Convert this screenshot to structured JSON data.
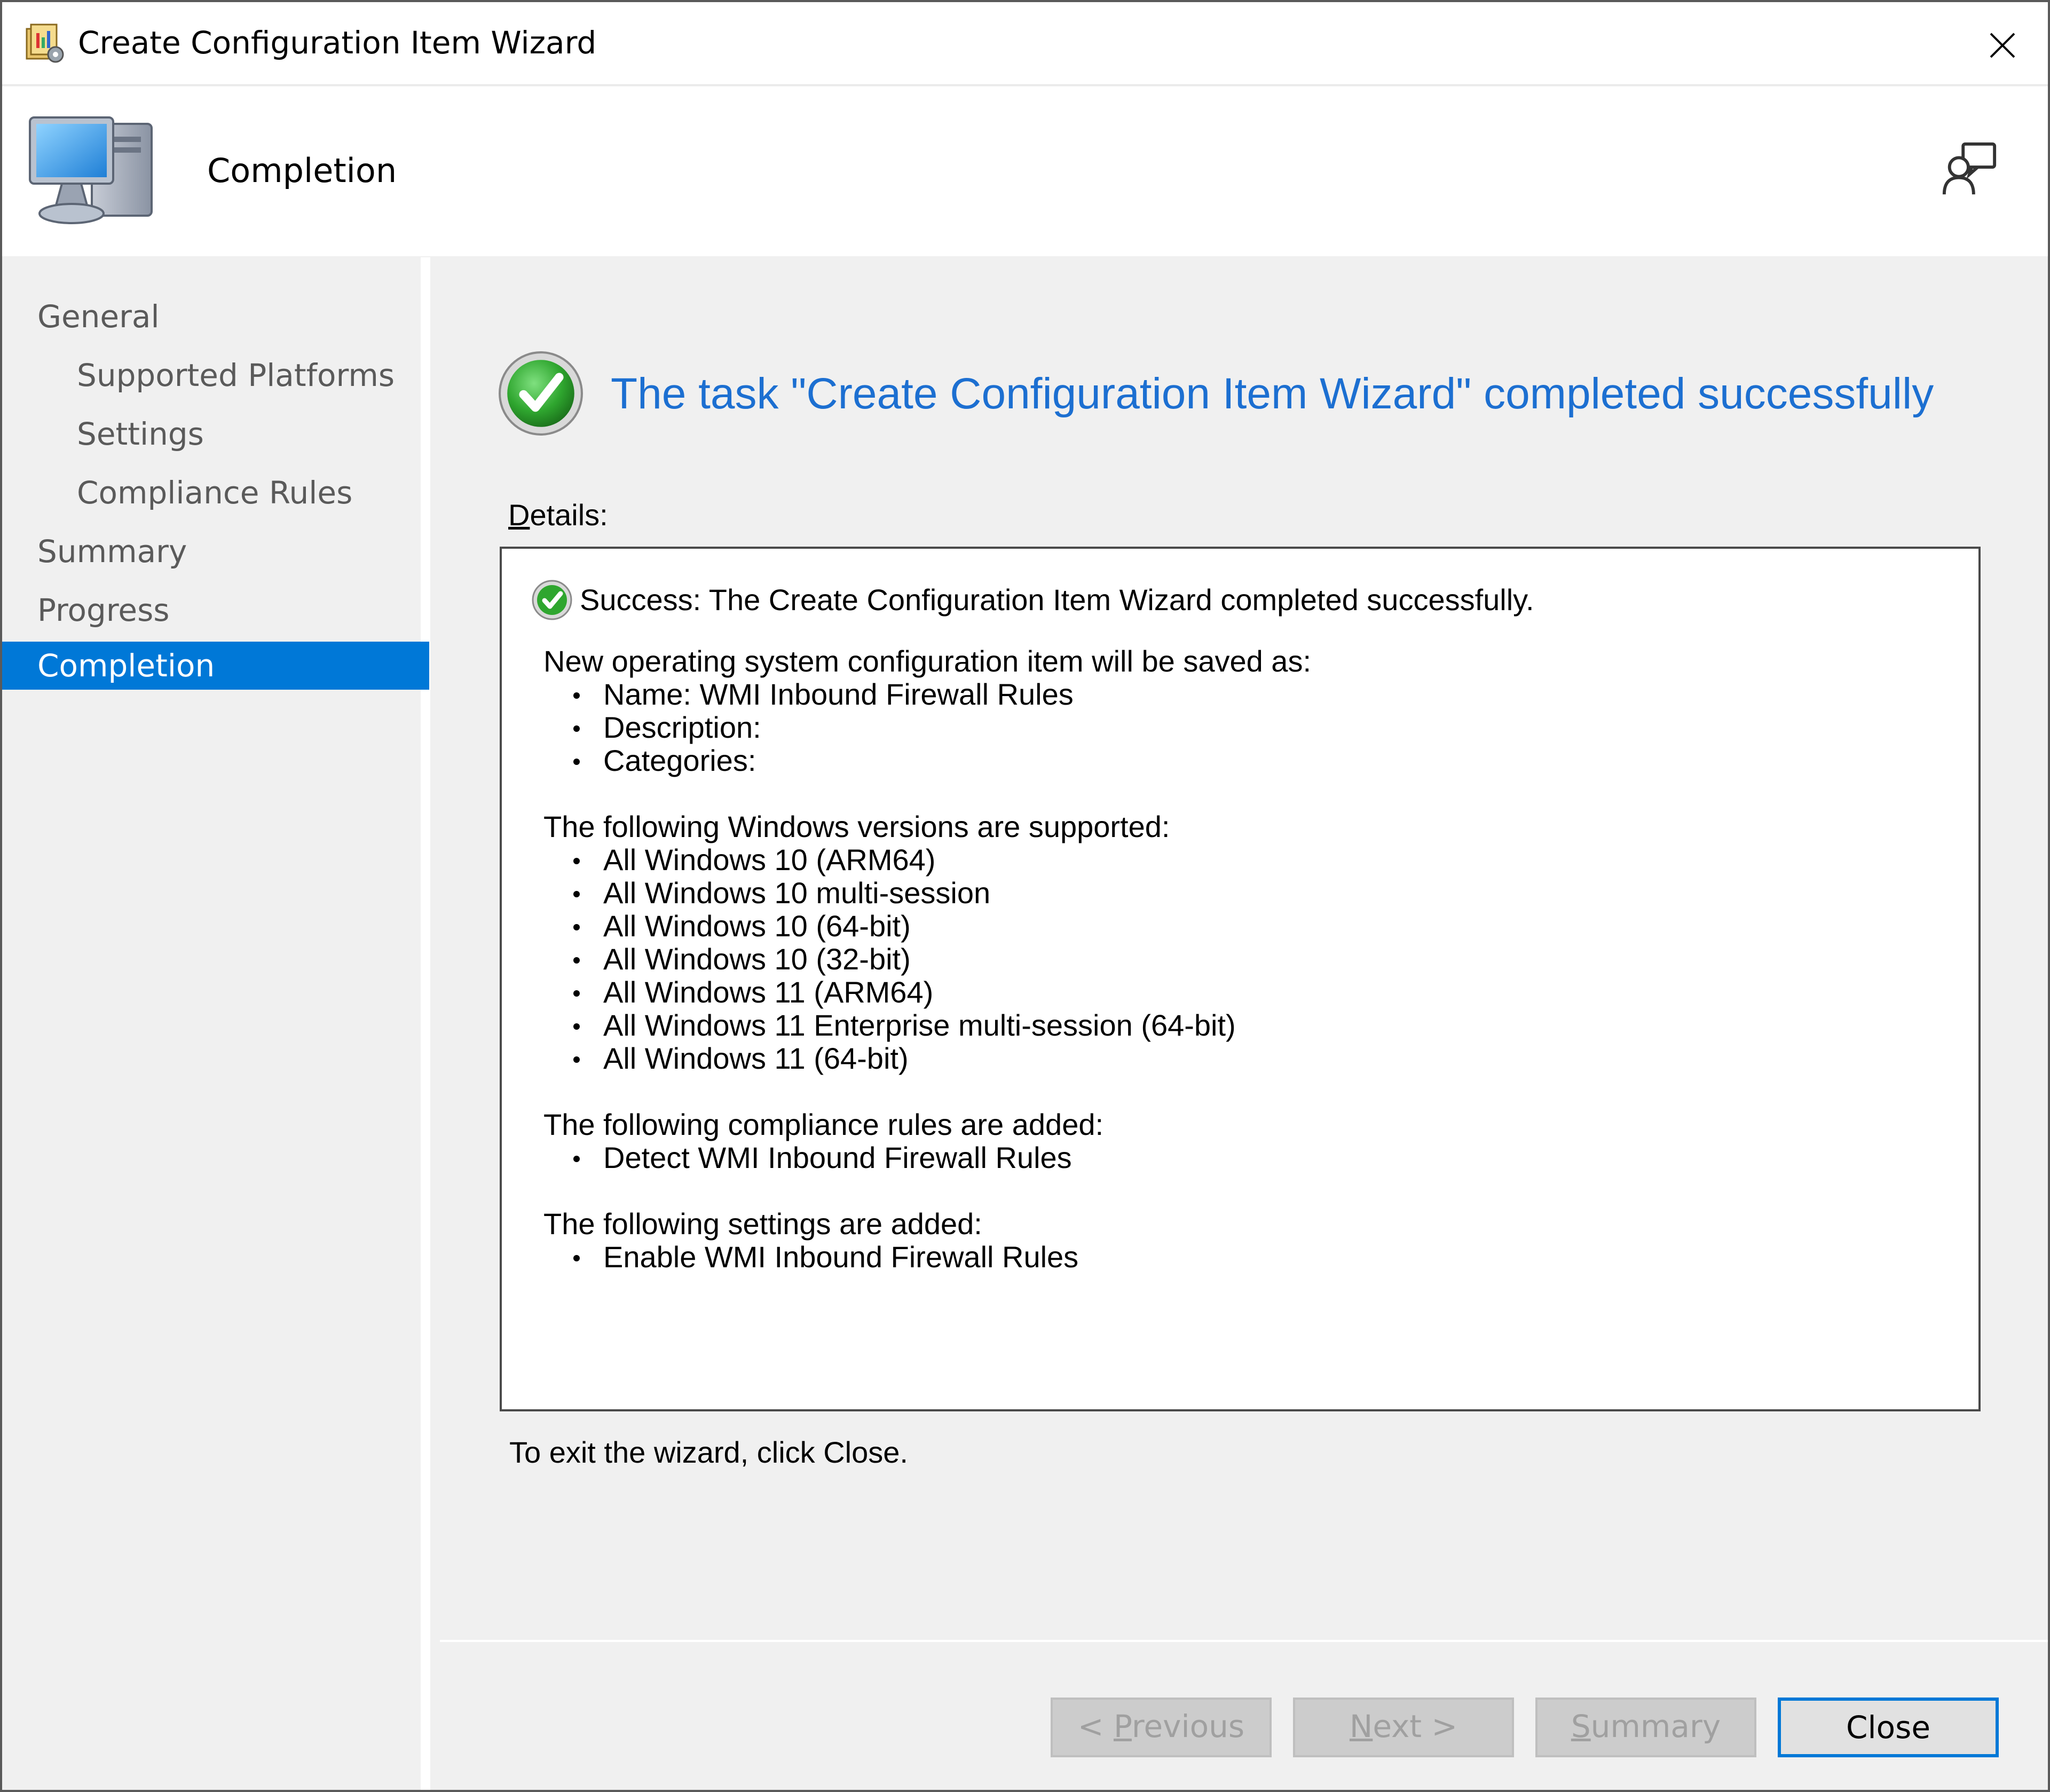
{
  "window": {
    "title": "Create Configuration Item Wizard"
  },
  "header": {
    "title": "Completion"
  },
  "nav": {
    "items": [
      {
        "label": "General",
        "level": 0,
        "active": false
      },
      {
        "label": "Supported Platforms",
        "level": 1,
        "active": false
      },
      {
        "label": "Settings",
        "level": 1,
        "active": false
      },
      {
        "label": "Compliance Rules",
        "level": 1,
        "active": false
      },
      {
        "label": "Summary",
        "level": 0,
        "active": false
      },
      {
        "label": "Progress",
        "level": 0,
        "active": false
      },
      {
        "label": "Completion",
        "level": 0,
        "active": true
      }
    ]
  },
  "main": {
    "headline": "The task \"Create Configuration Item Wizard\" completed successfully",
    "details_label_underlined": "D",
    "details_label_rest": "etails:",
    "success_message": "Success: The Create Configuration Item Wizard completed successfully.",
    "saved_as": {
      "heading": "New operating system configuration item will be saved as:",
      "items": [
        "Name: WMI Inbound Firewall Rules",
        "Description:",
        "Categories:"
      ]
    },
    "platforms": {
      "heading": "The following Windows versions are supported:",
      "items": [
        "All Windows 10 (ARM64)",
        "All Windows 10 multi-session",
        "All Windows 10 (64-bit)",
        "All Windows 10 (32-bit)",
        "All Windows 11 (ARM64)",
        "All Windows 11 Enterprise multi-session (64-bit)",
        "All Windows 11 (64-bit)"
      ]
    },
    "rules": {
      "heading": "The following compliance rules are added:",
      "items": [
        "Detect WMI Inbound Firewall Rules"
      ]
    },
    "settings": {
      "heading": "The following settings are added:",
      "items": [
        "Enable WMI Inbound Firewall Rules"
      ]
    },
    "exit_text": "To exit the wizard, click Close."
  },
  "buttons": {
    "previous": {
      "pre": "< ",
      "underlined": "P",
      "post": "revious",
      "enabled": false
    },
    "next": {
      "pre": "",
      "underlined": "N",
      "post": "ext >",
      "enabled": false
    },
    "summary": {
      "pre": "",
      "underlined": "S",
      "post": "ummary",
      "enabled": false
    },
    "close": {
      "label": "Close",
      "enabled": true
    }
  },
  "colors": {
    "accent": "#0078d7",
    "headline": "#1c6fd1",
    "success_green": "#2e9e2e",
    "disabled_text": "#a0a0a0"
  },
  "icons": [
    "app-wizard-icon",
    "close-icon",
    "computer-icon",
    "feedback-icon",
    "success-check-icon"
  ]
}
